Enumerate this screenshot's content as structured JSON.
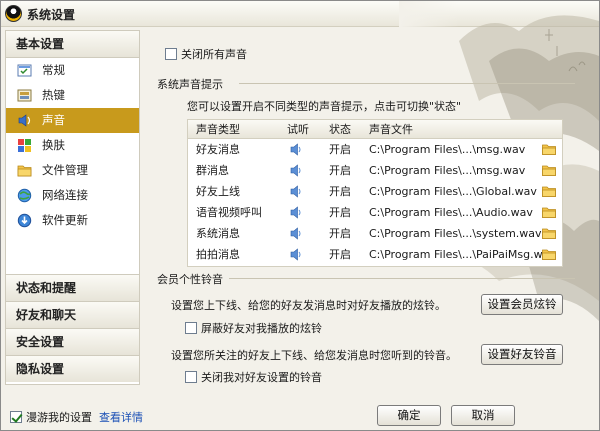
{
  "window": {
    "title": "系统设置"
  },
  "sidebar": {
    "header": "基本设置",
    "items": [
      {
        "label": "常规",
        "icon": "general-icon",
        "active": false
      },
      {
        "label": "热键",
        "icon": "hotkey-icon",
        "active": false
      },
      {
        "label": "声音",
        "icon": "sound-icon",
        "active": true
      },
      {
        "label": "换肤",
        "icon": "skin-icon",
        "active": false
      },
      {
        "label": "文件管理",
        "icon": "folder-icon",
        "active": false
      },
      {
        "label": "网络连接",
        "icon": "network-icon",
        "active": false
      },
      {
        "label": "软件更新",
        "icon": "update-icon",
        "active": false
      }
    ],
    "bottom_groups": [
      "状态和提醒",
      "好友和聊天",
      "安全设置",
      "隐私设置"
    ]
  },
  "main": {
    "mute_all_label": "关闭所有声音",
    "mute_all_checked": false,
    "system_section_title": "系统声音提示",
    "system_hint": "您可以设置开启不同类型的声音提示，点击可切换\"状态\"",
    "table": {
      "headers": [
        "声音类型",
        "试听",
        "状态",
        "声音文件"
      ],
      "rows": [
        {
          "type": "好友消息",
          "status": "开启",
          "file": "C:\\Program Files\\...\\msg.wav"
        },
        {
          "type": "群消息",
          "status": "开启",
          "file": "C:\\Program Files\\...\\msg.wav"
        },
        {
          "type": "好友上线",
          "status": "开启",
          "file": "C:\\Program Files\\...\\Global.wav"
        },
        {
          "type": "语音视频呼叫",
          "status": "开启",
          "file": "C:\\Program Files\\...\\Audio.wav"
        },
        {
          "type": "系统消息",
          "status": "开启",
          "file": "C:\\Program Files\\...\\system.wav"
        },
        {
          "type": "拍拍消息",
          "status": "开启",
          "file": "C:\\Program Files\\...\\PaiPaiMsg.wav"
        }
      ]
    },
    "member_section_title": "会员个性铃音",
    "member_text_1": "设置您上下线、给您的好友发消息时对好友播放的炫铃。",
    "member_button_1": "设置会员炫铃",
    "member_check_1": "屏蔽好友对我播放的炫铃",
    "member_text_2": "设置您所关注的好友上下线、给您发消息时您听到的铃音。",
    "member_button_2": "设置好友铃音",
    "member_check_2": "关闭我对好友设置的铃音"
  },
  "footer": {
    "roam_label": "漫游我的设置",
    "roam_checked": true,
    "details_link": "查看详情",
    "ok_label": "确定",
    "cancel_label": "取消"
  },
  "colors": {
    "active_item": "#c89a1c",
    "link": "#1a4fb5"
  }
}
